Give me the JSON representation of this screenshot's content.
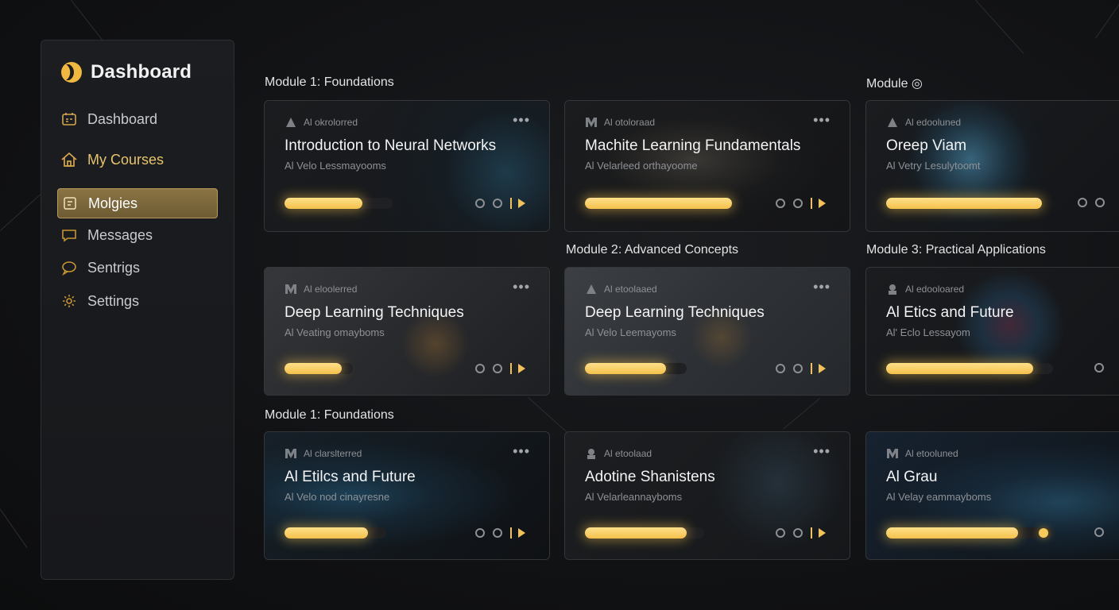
{
  "sidebar": {
    "title": "Dashboard",
    "items": [
      {
        "label": "Dashboard",
        "icon": "dashboard-icon"
      },
      {
        "label": "My Courses",
        "icon": "home-icon"
      },
      {
        "label": "Molgies",
        "icon": "modules-icon"
      },
      {
        "label": "Messages",
        "icon": "message-icon"
      },
      {
        "label": "Sentrigs",
        "icon": "chat-icon"
      },
      {
        "label": "Settings",
        "icon": "gear-icon"
      }
    ]
  },
  "headings": {
    "h1": "Module 1: Foundations",
    "h2": "Module ◎",
    "h3": "Module 2: Advanced Concepts",
    "h4": "Module 3: Practical Applications",
    "h5": "Module 1: Foundations"
  },
  "cards": [
    {
      "meta": "Al okrolorred",
      "title": "Introduction to Neural Networks",
      "sub": "Al Velo Lessmayooms",
      "progress": 0.72
    },
    {
      "meta": "Al otoloraad",
      "title": "Machite Learning Fundamentals",
      "sub": "Al Velarleed orthayoome",
      "progress": 1.0
    },
    {
      "meta": "Al edooluned",
      "title": "Oreep Viam",
      "sub": "Al Vetry Lesulytoomt",
      "progress": 1.0
    },
    {
      "meta": "Al eloolerred",
      "title": "Deep Learning Techniques",
      "sub": "Al Veating omayboms",
      "progress": 0.84
    },
    {
      "meta": "Al etoolaaed",
      "title": "Deep Learning Techniques",
      "sub": "Al Velo Leemayoms",
      "progress": 0.8
    },
    {
      "meta": "Al edooloared",
      "title": "Al Etics and Future",
      "sub": "Al' Eclo Lessayom",
      "progress": 0.88
    },
    {
      "meta": "Al clarslterred",
      "title": "Al Etilcs and Future",
      "sub": "Al Velo nod cinayresne",
      "progress": 0.82
    },
    {
      "meta": "Al etoolaad",
      "title": "Adotine Shanistens",
      "sub": "Al Velarleannayboms",
      "progress": 0.85
    },
    {
      "meta": "Al etooluned",
      "title": "Al Grau",
      "sub": "Al Velay eammayboms",
      "progress": 0.79
    }
  ],
  "colors": {
    "accent": "#f4c14c",
    "active_nav": "#7d6a3e",
    "background": "#111214"
  }
}
